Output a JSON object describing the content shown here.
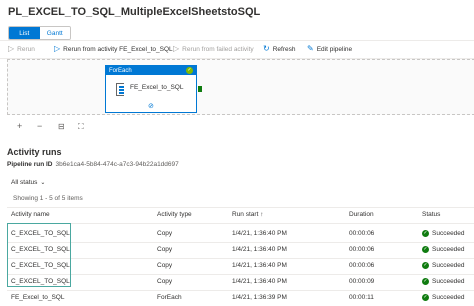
{
  "pipeline": {
    "title": "PL_EXCEL_TO_SQL_MultipleExcelSheetstoSQL"
  },
  "view_toggle": {
    "list": "List",
    "gantt": "Gantt"
  },
  "toolbar": {
    "rerun": "Rerun",
    "rerun_from_activity": "Rerun from activity FE_Excel_to_SQL",
    "rerun_failed": "Rerun from failed activity",
    "refresh": "Refresh",
    "edit_pipeline": "Edit pipeline"
  },
  "canvas_node": {
    "type": "ForEach",
    "label": "FE_Excel_to_SQL"
  },
  "activity_runs": {
    "heading": "Activity runs",
    "run_id_label": "Pipeline run ID",
    "run_id": "3b6e1ca4-5b84-474c-a7c3-94b22a1dd697",
    "status_filter": "All status",
    "showing": "Showing 1 - 5 of 5 items",
    "columns": [
      "Activity name",
      "Activity type",
      "Run start",
      "Duration",
      "Status"
    ],
    "rows": [
      {
        "name": "C_EXCEL_TO_SQL",
        "type": "Copy",
        "start": "1/4/21, 1:36:40 PM",
        "duration": "00:00:06",
        "status": "Succeeded"
      },
      {
        "name": "C_EXCEL_TO_SQL",
        "type": "Copy",
        "start": "1/4/21, 1:36:40 PM",
        "duration": "00:00:06",
        "status": "Succeeded"
      },
      {
        "name": "C_EXCEL_TO_SQL",
        "type": "Copy",
        "start": "1/4/21, 1:36:40 PM",
        "duration": "00:00:06",
        "status": "Succeeded"
      },
      {
        "name": "C_EXCEL_TO_SQL",
        "type": "Copy",
        "start": "1/4/21, 1:36:40 PM",
        "duration": "00:00:09",
        "status": "Succeeded"
      },
      {
        "name": "FE_Excel_to_SQL",
        "type": "ForEach",
        "start": "1/4/21, 1:36:39 PM",
        "duration": "00:00:11",
        "status": "Succeeded"
      }
    ]
  },
  "colors": {
    "accent": "#0078d4",
    "success": "#107c10",
    "selection": "#4aa8a0"
  }
}
